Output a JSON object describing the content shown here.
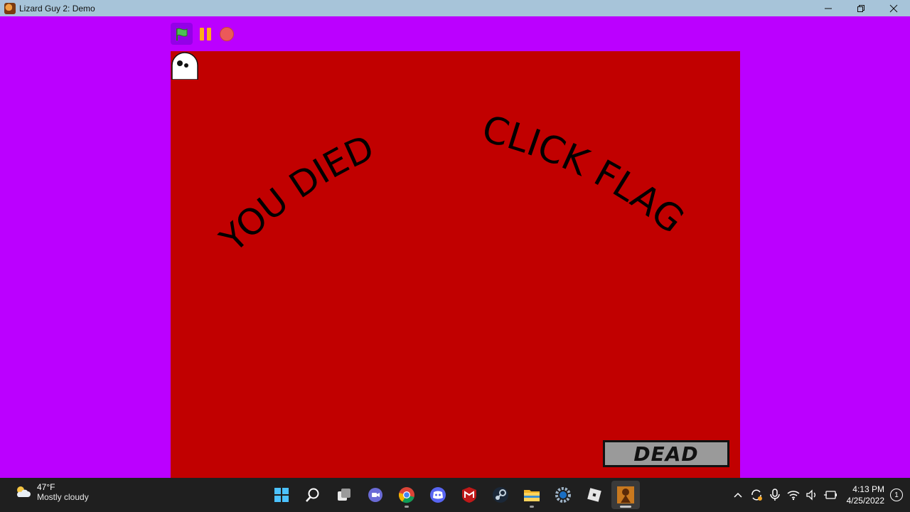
{
  "window": {
    "title": "Lizard Guy 2: Demo",
    "icon": "lizard-app-icon",
    "controls": [
      "minimize-icon",
      "restore-icon",
      "close-icon"
    ]
  },
  "player": {
    "green_flag": "green-flag-icon",
    "pause": "pause-icon",
    "stop": "stop-icon"
  },
  "stage": {
    "background_color": "#c10000",
    "left_text": "YOU DIED",
    "right_text": "CLICK FLAG",
    "status_box": "DEAD",
    "sprite": "ghost-sprite"
  },
  "taskbar": {
    "weather": {
      "temp": "47°F",
      "desc": "Mostly cloudy",
      "icon": "cloud-sun-icon"
    },
    "apps": [
      "windows-start-icon",
      "search-icon",
      "task-view-icon",
      "chat-icon",
      "chrome-icon",
      "discord-icon",
      "mcafee-icon",
      "steam-icon",
      "file-explorer-icon",
      "settings-icon",
      "roblox-icon",
      "lizard-guy-app-icon"
    ],
    "tray": [
      "chevron-up-icon",
      "sync-icon",
      "microphone-icon",
      "wifi-icon",
      "speaker-icon",
      "battery-icon"
    ],
    "clock": {
      "time": "4:13 PM",
      "date": "4/25/2022"
    },
    "notification_count": "1"
  }
}
